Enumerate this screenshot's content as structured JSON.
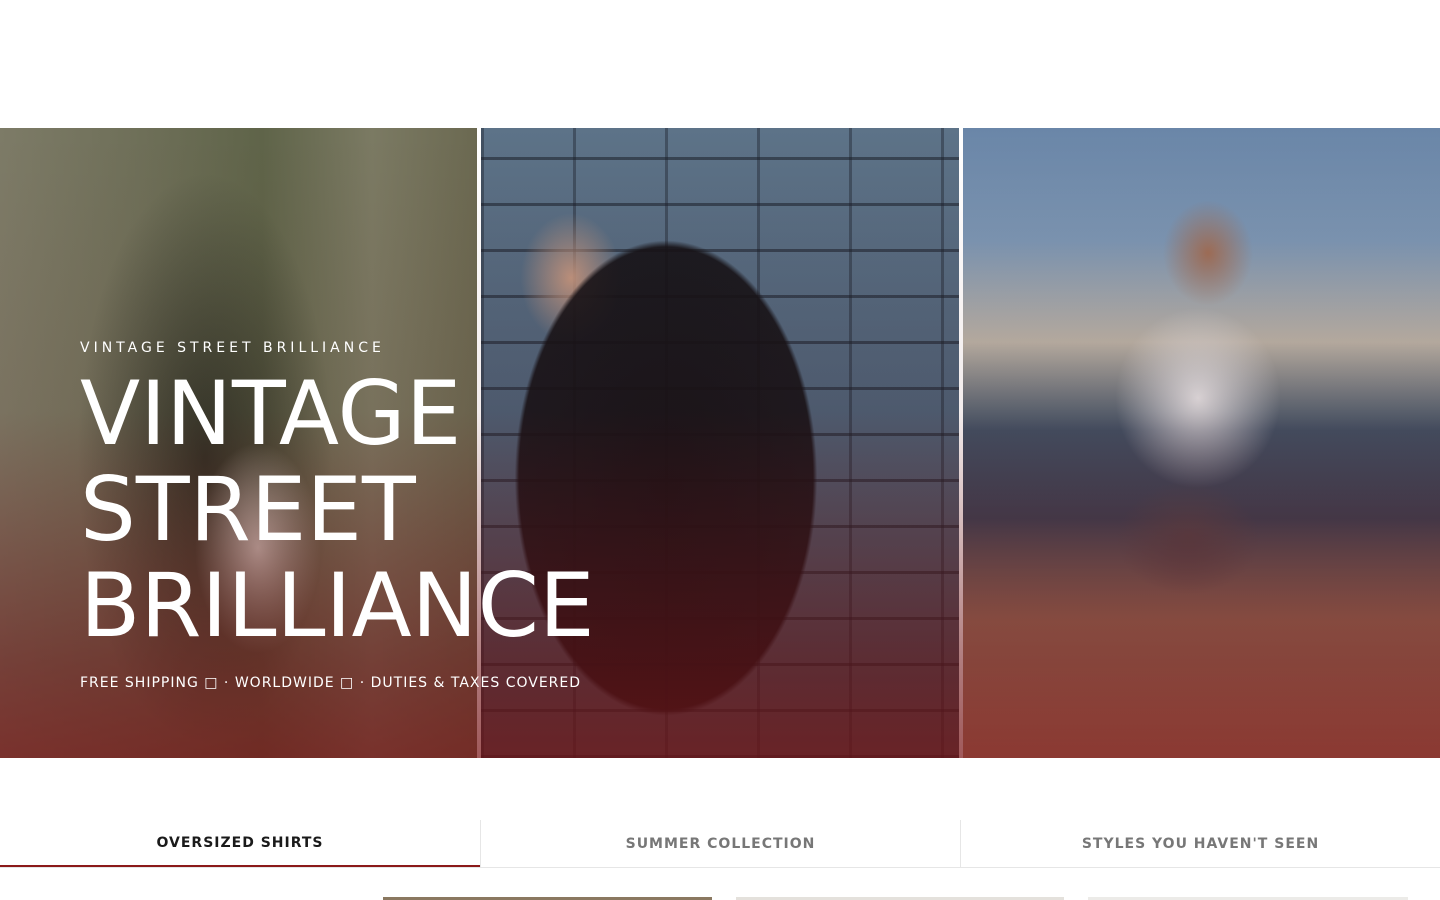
{
  "hero": {
    "eyebrow": "VINTAGE STREET BRILLIANCE",
    "title_lines": [
      "VINTAGE",
      "STREET",
      "BRILLIANCE"
    ],
    "shipping_text": "FREE SHIPPING □ · WORLDWIDE □ · DUTIES & TAXES COVERED",
    "panels": [
      {
        "description": "street-photo-left"
      },
      {
        "description": "street-photo-center"
      },
      {
        "description": "street-photo-right"
      }
    ]
  },
  "tabs": [
    {
      "label": "OVERSIZED SHIRTS",
      "active": true
    },
    {
      "label": "SUMMER COLLECTION",
      "active": false
    },
    {
      "label": "STYLES YOU HAVEN'T SEEN",
      "active": false
    }
  ],
  "colors": {
    "accent": "#8b1a1a",
    "tab_active_text": "#1a1a1a",
    "tab_inactive_text": "#777777"
  }
}
